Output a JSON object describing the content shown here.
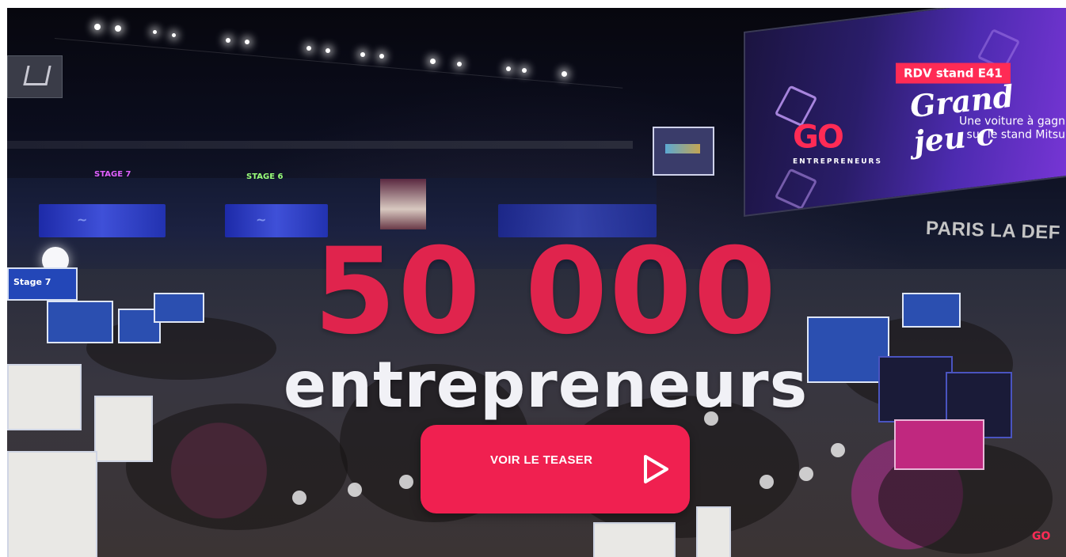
{
  "hero": {
    "headline_number": "50 000",
    "headline_word": "entrepreneurs",
    "cta": {
      "label": "VOIR LE TEASER",
      "icon": "play-icon",
      "color": "#f02050"
    }
  },
  "scene": {
    "stage_labels": [
      "STAGE 7",
      "STAGE 6",
      "Stage 7"
    ],
    "big_screen": {
      "badge": "RDV stand E41",
      "headline": "Grand jeu c",
      "subline_1": "Une voiture à gagn",
      "subline_2": "sur le stand Mitsu",
      "logo": "GO",
      "logo_sub": "ENTREPRENEURS"
    },
    "venue_sign": "PARIS LA DEF"
  },
  "colors": {
    "accent": "#e8244e",
    "headline_white": "#f1f1f6"
  }
}
